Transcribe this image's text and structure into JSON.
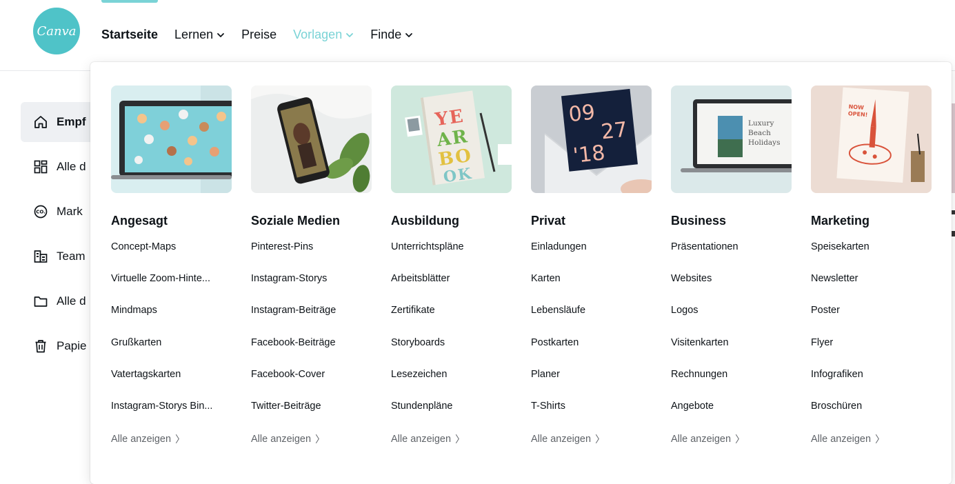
{
  "brand": {
    "logo_text": "Canva",
    "accent": "#4fc3c8",
    "highlight": "#7ad3d6"
  },
  "nav": {
    "items": [
      {
        "label": "Startseite",
        "dropdown": false,
        "state": "active"
      },
      {
        "label": "Lernen",
        "dropdown": true,
        "state": "normal"
      },
      {
        "label": "Preise",
        "dropdown": false,
        "state": "normal"
      },
      {
        "label": "Vorlagen",
        "dropdown": true,
        "state": "open"
      },
      {
        "label": "Finde",
        "dropdown": true,
        "state": "normal"
      }
    ]
  },
  "sidebar": {
    "items": [
      {
        "label": "Empf",
        "icon": "home-icon",
        "active": true
      },
      {
        "label": "Alle d",
        "icon": "grid-icon",
        "active": false
      },
      {
        "label": "Mark",
        "icon": "brand-kit-icon",
        "active": false
      },
      {
        "label": "Team",
        "icon": "team-building-icon",
        "active": false
      },
      {
        "label": "Alle d",
        "icon": "folder-icon",
        "active": false
      },
      {
        "label": "Papie",
        "icon": "trash-icon",
        "active": false
      }
    ]
  },
  "menu": {
    "see_all_label": "Alle anzeigen",
    "columns": [
      {
        "title": "Angesagt",
        "thumb_text": "",
        "links": [
          "Concept-Maps",
          "Virtuelle Zoom-Hinte...",
          "Mindmaps",
          "Grußkarten",
          "Vatertagskarten",
          "Instagram-Storys Bin..."
        ]
      },
      {
        "title": "Soziale Medien",
        "thumb_text": "",
        "links": [
          "Pinterest-Pins",
          "Instagram-Storys",
          "Instagram-Beiträge",
          "Facebook-Beiträge",
          "Facebook-Cover",
          "Twitter-Beiträge"
        ]
      },
      {
        "title": "Ausbildung",
        "thumb_text": "YEARBOOK",
        "links": [
          "Unterrichtspläne",
          "Arbeitsblätter",
          "Zertifikate",
          "Storyboards",
          "Lesezeichen",
          "Stundenpläne"
        ]
      },
      {
        "title": "Privat",
        "thumb_text": "09 27 '18",
        "links": [
          "Einladungen",
          "Karten",
          "Lebensläufe",
          "Postkarten",
          "Planer",
          "T-Shirts"
        ]
      },
      {
        "title": "Business",
        "thumb_text": "Luxury Beach Holidays",
        "links": [
          "Präsentationen",
          "Websites",
          "Logos",
          "Visitenkarten",
          "Rechnungen",
          "Angebote"
        ]
      },
      {
        "title": "Marketing",
        "thumb_text": "NOW OPEN!",
        "links": [
          "Speisekarten",
          "Newsletter",
          "Poster",
          "Flyer",
          "Infografiken",
          "Broschüren"
        ]
      }
    ]
  }
}
